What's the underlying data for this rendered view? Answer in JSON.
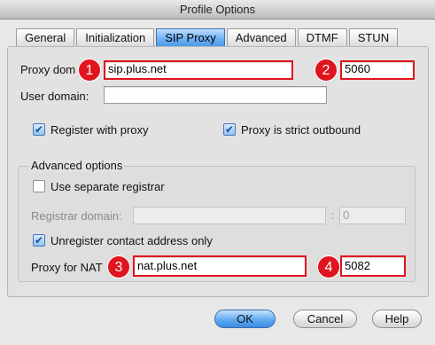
{
  "window": {
    "title": "Profile Options"
  },
  "tabs": [
    "General",
    "Initialization",
    "SIP Proxy",
    "Advanced",
    "DTMF",
    "STUN"
  ],
  "active_tab": "SIP Proxy",
  "form": {
    "proxy_domain_label": "Proxy dom",
    "proxy_domain_value": "sip.plus.net",
    "proxy_port_value": "5060",
    "user_domain_label": "User domain:",
    "user_domain_value": "",
    "register_label": "Register with proxy",
    "register_checked": true,
    "strict_outbound_label": "Proxy is strict outbound",
    "strict_outbound_checked": true
  },
  "advanced": {
    "legend": "Advanced options",
    "separate_registrar_label": "Use separate registrar",
    "separate_registrar_checked": false,
    "registrar_domain_label": "Registrar domain:",
    "registrar_domain_value": "",
    "registrar_port_separator": ":",
    "registrar_port_value": "0",
    "unregister_label": "Unregister contact address only",
    "unregister_checked": true,
    "nat_proxy_label": "Proxy for NAT",
    "nat_proxy_value": "nat.plus.net",
    "nat_port_value": "5082"
  },
  "annotations": [
    "1",
    "2",
    "3",
    "4"
  ],
  "annotation_color": "#e0141e",
  "check_mark": "✔",
  "buttons": {
    "ok": "OK",
    "cancel": "Cancel",
    "help": "Help"
  }
}
